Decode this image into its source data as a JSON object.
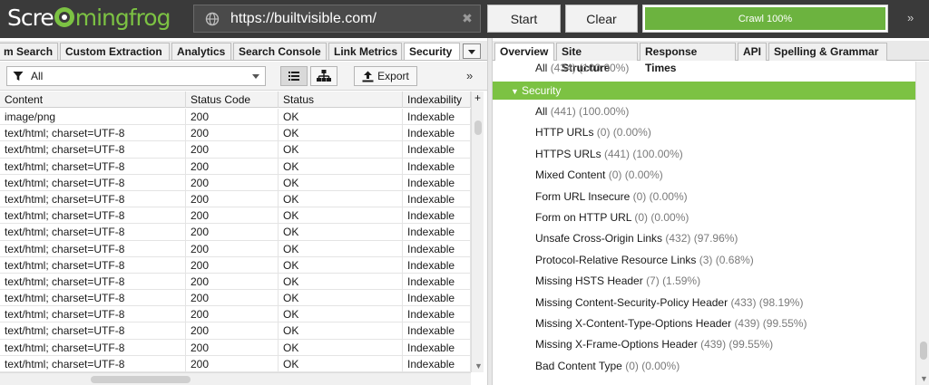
{
  "app": {
    "logo_text_a": "Scre",
    "logo_text_b": "mingfrog",
    "url": "https://builtvisible.com/",
    "start_label": "Start",
    "clear_label": "Clear",
    "crawl_label": "Crawl 100%",
    "crawl_progress": 1.0,
    "more_glyph": "»",
    "accent_color": "#7cc243"
  },
  "left_tabs": [
    "m Search",
    "Custom Extraction",
    "Analytics",
    "Search Console",
    "Link Metrics",
    "Security"
  ],
  "left_active_tab": "Security",
  "toolbar": {
    "filter_value": "All",
    "export_label": "Export",
    "more_glyph": "»"
  },
  "grid": {
    "columns": [
      "Content",
      "Status Code",
      "Status",
      "Indexability"
    ],
    "add_column_glyph": "+",
    "rows": [
      [
        "image/png",
        "200",
        "OK",
        "Indexable"
      ],
      [
        "text/html; charset=UTF-8",
        "200",
        "OK",
        "Indexable"
      ],
      [
        "text/html; charset=UTF-8",
        "200",
        "OK",
        "Indexable"
      ],
      [
        "text/html; charset=UTF-8",
        "200",
        "OK",
        "Indexable"
      ],
      [
        "text/html; charset=UTF-8",
        "200",
        "OK",
        "Indexable"
      ],
      [
        "text/html; charset=UTF-8",
        "200",
        "OK",
        "Indexable"
      ],
      [
        "text/html; charset=UTF-8",
        "200",
        "OK",
        "Indexable"
      ],
      [
        "text/html; charset=UTF-8",
        "200",
        "OK",
        "Indexable"
      ],
      [
        "text/html; charset=UTF-8",
        "200",
        "OK",
        "Indexable"
      ],
      [
        "text/html; charset=UTF-8",
        "200",
        "OK",
        "Indexable"
      ],
      [
        "text/html; charset=UTF-8",
        "200",
        "OK",
        "Indexable"
      ],
      [
        "text/html; charset=UTF-8",
        "200",
        "OK",
        "Indexable"
      ],
      [
        "text/html; charset=UTF-8",
        "200",
        "OK",
        "Indexable"
      ],
      [
        "text/html; charset=UTF-8",
        "200",
        "OK",
        "Indexable"
      ],
      [
        "text/html; charset=UTF-8",
        "200",
        "OK",
        "Indexable"
      ],
      [
        "text/html; charset=UTF-8",
        "200",
        "OK",
        "Indexable"
      ]
    ]
  },
  "right_tabs": [
    "Overview",
    "Site Structure",
    "Response Times",
    "API",
    "Spelling & Grammar"
  ],
  "right_active_tab": "Overview",
  "overview": {
    "above_item": {
      "label": "All",
      "count": "(434) (100.00%)"
    },
    "group_label": "Security",
    "items": [
      {
        "label": "All",
        "count": "(441) (100.00%)"
      },
      {
        "label": "HTTP URLs",
        "count": "(0) (0.00%)"
      },
      {
        "label": "HTTPS URLs",
        "count": "(441) (100.00%)"
      },
      {
        "label": "Mixed Content",
        "count": "(0) (0.00%)"
      },
      {
        "label": "Form URL Insecure",
        "count": "(0) (0.00%)"
      },
      {
        "label": "Form on HTTP URL",
        "count": "(0) (0.00%)"
      },
      {
        "label": "Unsafe Cross-Origin Links",
        "count": "(432) (97.96%)"
      },
      {
        "label": "Protocol-Relative Resource Links",
        "count": "(3) (0.68%)"
      },
      {
        "label": "Missing HSTS Header",
        "count": "(7) (1.59%)"
      },
      {
        "label": "Missing Content-Security-Policy Header",
        "count": "(433) (98.19%)"
      },
      {
        "label": "Missing X-Content-Type-Options Header",
        "count": "(439) (99.55%)"
      },
      {
        "label": "Missing X-Frame-Options Header",
        "count": "(439) (99.55%)"
      },
      {
        "label": "Bad Content Type",
        "count": "(0) (0.00%)"
      }
    ]
  }
}
